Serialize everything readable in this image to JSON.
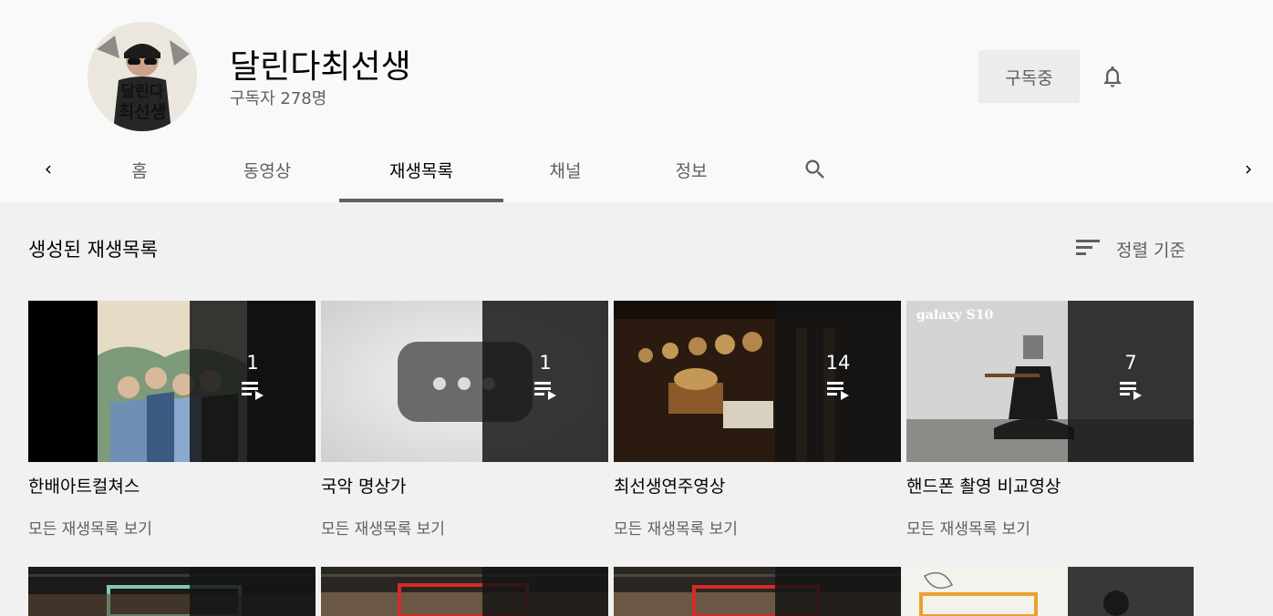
{
  "channel": {
    "name": "달린다최선생",
    "subscribers": "구독자 278명",
    "subscribe_label": "구독중",
    "avatar_text_line1": "달린다",
    "avatar_text_line2": "최선생"
  },
  "tabs": [
    {
      "label": "홈"
    },
    {
      "label": "동영상"
    },
    {
      "label": "재생목록"
    },
    {
      "label": "채널"
    },
    {
      "label": "정보"
    }
  ],
  "active_tab": 2,
  "section": {
    "title": "생성된 재생목록",
    "sort_label": "정렬 기준"
  },
  "playlists": [
    {
      "title": "한배아트컬쳐스",
      "count": "1",
      "link": "모든 재생목록 보기"
    },
    {
      "title": "국악 명상가",
      "count": "1",
      "link": "모든 재생목록 보기"
    },
    {
      "title": "최선생연주영상",
      "count": "14",
      "link": "모든 재생목록 보기"
    },
    {
      "title": "핸드폰 촬영 비교영상",
      "count": "7",
      "link": "모든 재생목록 보기",
      "thumb_caption": "galaxy S10"
    }
  ],
  "colors": {
    "header_bg": "#f9f9f9",
    "page_bg": "#f1f1f1",
    "text_primary": "#030303",
    "text_secondary": "#606060",
    "subscribe_bg": "#ececec"
  },
  "icons": {
    "prev": "chevron-left-icon",
    "next": "chevron-right-icon",
    "search": "search-icon",
    "bell": "bell-icon",
    "sort": "sort-icon",
    "playlist": "playlist-play-icon"
  }
}
